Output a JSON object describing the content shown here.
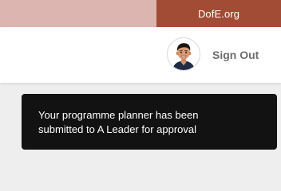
{
  "top_bar": {
    "site_link": "DofE.org",
    "colors": {
      "left_strip": "#dcb5b0",
      "site_link_bg": "#a24c35"
    }
  },
  "header": {
    "avatar_icon": "user-avatar-cartoon",
    "sign_out_label": "Sign Out"
  },
  "toast": {
    "line1": "Your programme planner has been",
    "line2": "submitted to A Leader for approval",
    "background": "#121212"
  }
}
